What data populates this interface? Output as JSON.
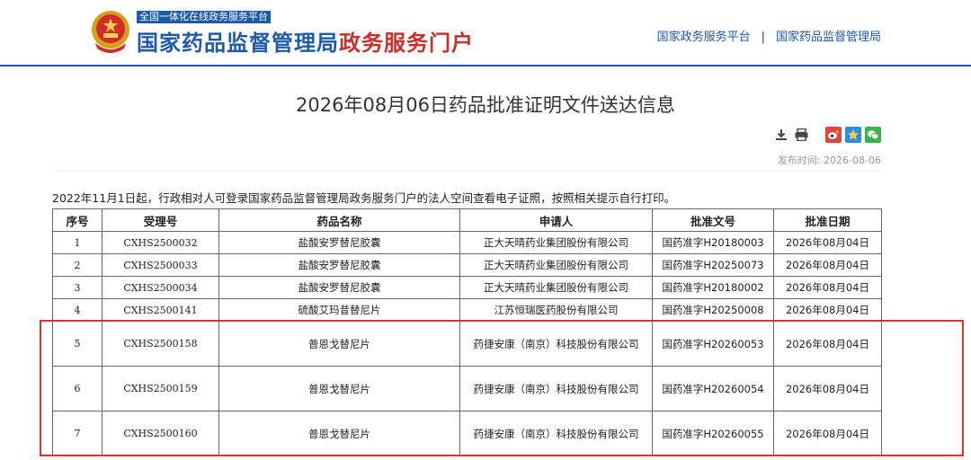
{
  "header": {
    "slogan": "全国一体化在线政务服务平台",
    "site_title_blue": "国家药品监督管理局",
    "site_title_red": "政务服务门户",
    "links": [
      "国家政务服务平台",
      "国家药品监督管理局"
    ],
    "link_separator": "|"
  },
  "title": "2026年08月06日药品批准证明文件送达信息",
  "tools": {
    "icons": [
      "download-icon",
      "print-icon",
      "weibo-icon",
      "favorite-icon",
      "wechat-icon"
    ]
  },
  "publish": {
    "label": "发布时间:",
    "date": "2026-08-06"
  },
  "notice": "2022年11月1日起，行政相对人可登录国家药品监督管理局政务服务门户的法人空间查看电子证照，按照相关提示自行打印。",
  "table": {
    "headers": [
      "序号",
      "受理号",
      "药品名称",
      "申请人",
      "批准文号",
      "批准日期"
    ],
    "rows": [
      [
        "1",
        "CXHS2500032",
        "盐酸安罗替尼胶囊",
        "正大天晴药业集团股份有限公司",
        "国药准字H20180003",
        "2026年08月04日"
      ],
      [
        "2",
        "CXHS2500033",
        "盐酸安罗替尼胶囊",
        "正大天晴药业集团股份有限公司",
        "国药准字H20250073",
        "2026年08月04日"
      ],
      [
        "3",
        "CXHS2500034",
        "盐酸安罗替尼胶囊",
        "正大天晴药业集团股份有限公司",
        "国药准字H20180002",
        "2026年08月04日"
      ],
      [
        "4",
        "CXHS2500141",
        "硫酸艾玛昔替尼片",
        "江苏恒瑞医药股份有限公司",
        "国药准字H20250008",
        "2026年08月04日"
      ],
      [
        "5",
        "CXHS2500158",
        "普恩戈替尼片",
        "药捷安康（南京）科技股份有限公司",
        "国药准字H20260053",
        "2026年08月04日"
      ],
      [
        "6",
        "CXHS2500159",
        "普恩戈替尼片",
        "药捷安康（南京）科技股份有限公司",
        "国药准字H20260054",
        "2026年08月04日"
      ],
      [
        "7",
        "CXHS2500160",
        "普恩戈替尼片",
        "药捷安康（南京）科技股份有限公司",
        "国药准字H20260055",
        "2026年08月04日"
      ]
    ]
  },
  "colors": {
    "brand_blue": "#1e5aa8",
    "brand_red": "#c8302b",
    "highlight_red": "#e03030"
  }
}
